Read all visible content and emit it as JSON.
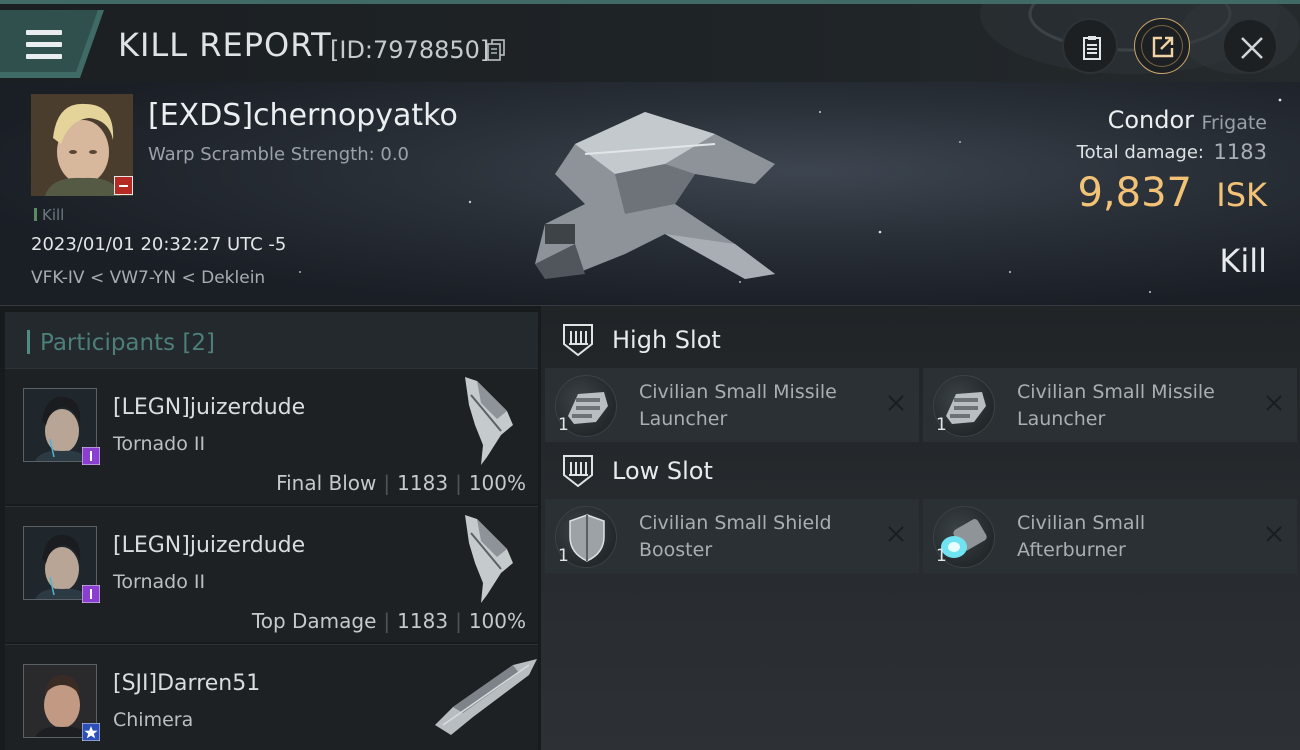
{
  "header": {
    "title": "KILL REPORT",
    "report_id": "[ID:7978850]"
  },
  "victim": {
    "name": "[EXDS]chernopyatko",
    "warp_scramble": "Warp Scramble Strength: 0.0",
    "kill_tag": "Kill",
    "datetime": "2023/01/01 20:32:27 UTC -5",
    "location": "VFK-IV < VW7-YN < Deklein",
    "ship_name": "Condor",
    "ship_class": "Frigate",
    "total_damage_label": "Total damage:",
    "total_damage": "1183",
    "isk_value": "9,837",
    "isk_unit": "ISK",
    "kill_label": "Kill"
  },
  "participants": {
    "header": "Participants",
    "count": "[2]",
    "items": [
      {
        "name": "[LEGN]juizerdude",
        "ship": "Tornado II",
        "role": "Final Blow",
        "damage": "1183",
        "percent": "100%"
      },
      {
        "name": "[LEGN]juizerdude",
        "ship": "Tornado II",
        "role": "Top Damage",
        "damage": "1183",
        "percent": "100%"
      },
      {
        "name": "[SJI]Darren51",
        "ship": "Chimera"
      }
    ]
  },
  "fitting": {
    "high_slot_label": "High Slot",
    "low_slot_label": "Low Slot",
    "high": [
      {
        "qty": "1",
        "name": "Civilian Small Missile Launcher"
      },
      {
        "qty": "1",
        "name": "Civilian Small Missile Launcher"
      }
    ],
    "low": [
      {
        "qty": "1",
        "name": "Civilian Small Shield Booster"
      },
      {
        "qty": "1",
        "name": "Civilian Small Afterburner"
      }
    ]
  },
  "colors": {
    "accent_teal": "#4f8c86",
    "isk_gold": "#f2c377",
    "badge_purple": "#8a3fd1",
    "badge_blue": "#2d4fb8"
  }
}
